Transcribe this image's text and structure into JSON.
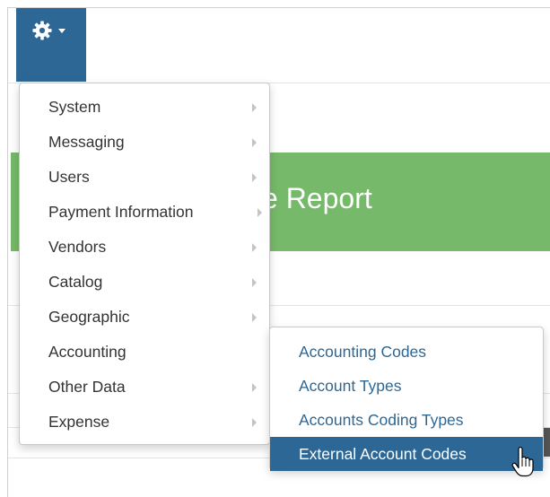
{
  "toolbar": {
    "settings_icon": "gear-icon",
    "caret_icon": "caret-down-icon",
    "button_color": "#2c6796"
  },
  "banner": {
    "title_fragment": "e Report",
    "color": "#76b96a"
  },
  "menu": {
    "items": [
      {
        "label": "System",
        "has_submenu": true
      },
      {
        "label": "Messaging",
        "has_submenu": true
      },
      {
        "label": "Users",
        "has_submenu": true
      },
      {
        "label": "Payment Information",
        "has_submenu": true
      },
      {
        "label": "Vendors",
        "has_submenu": true
      },
      {
        "label": "Catalog",
        "has_submenu": true
      },
      {
        "label": "Geographic",
        "has_submenu": true
      },
      {
        "label": "Accounting",
        "has_submenu": false
      },
      {
        "label": "Other Data",
        "has_submenu": true
      },
      {
        "label": "Expense",
        "has_submenu": true
      }
    ]
  },
  "submenu": {
    "items": [
      {
        "label": "Accounting Codes",
        "active": false
      },
      {
        "label": "Account Types",
        "active": false
      },
      {
        "label": "Accounts Coding Types",
        "active": false
      },
      {
        "label": "External Account Codes",
        "active": true
      }
    ],
    "link_color": "#2c6796",
    "active_bg": "#2c6796"
  },
  "cursor": {
    "icon": "hand-pointer-icon"
  }
}
